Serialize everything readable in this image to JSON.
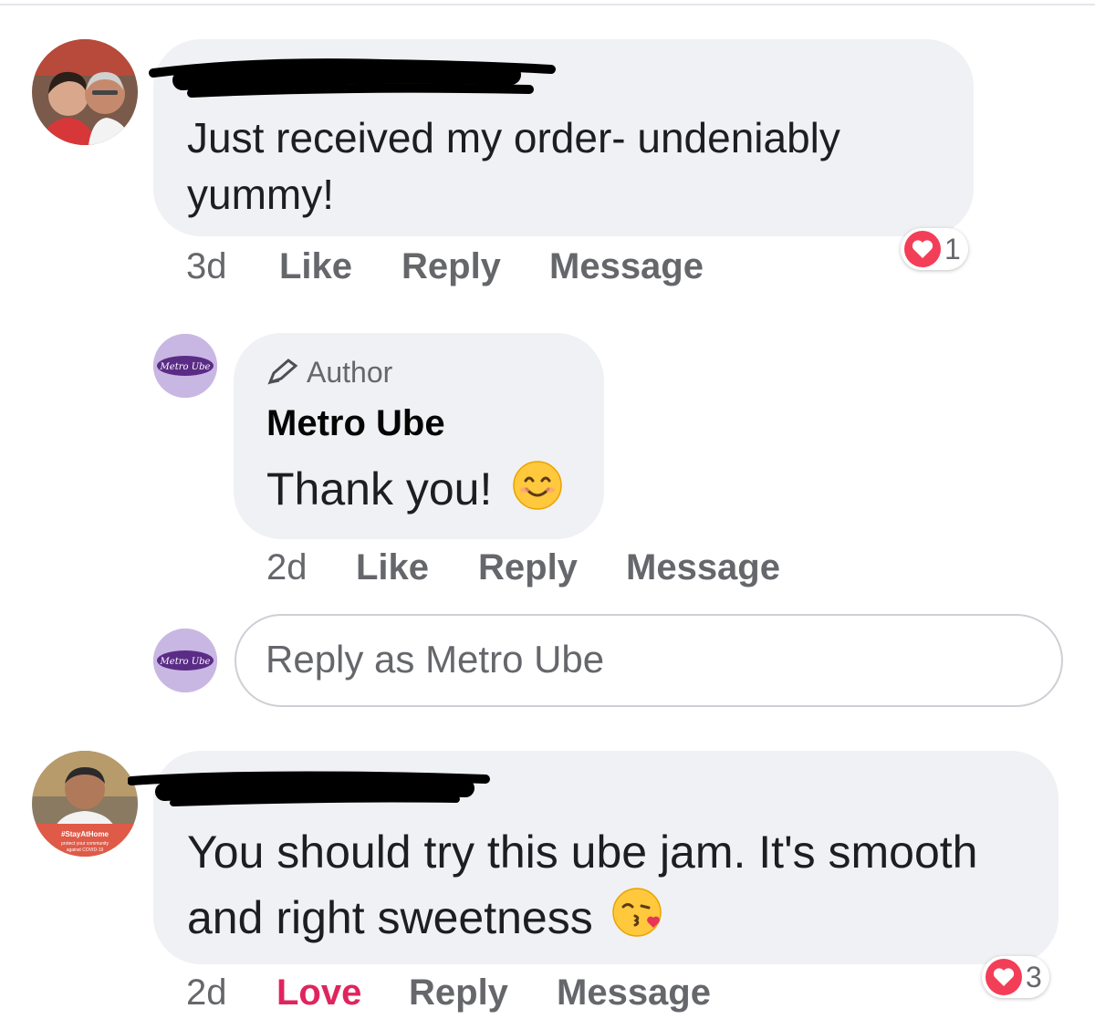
{
  "comments": [
    {
      "text": "Just received my order- undeniably yummy!",
      "time": "3d",
      "actions": {
        "like": "Like",
        "reply": "Reply",
        "message": "Message"
      },
      "reaction_count": "1"
    },
    {
      "badge": "Author",
      "author": "Metro Ube",
      "text": "Thank you!",
      "emoji": "smiling-face-icon",
      "time": "2d",
      "actions": {
        "like": "Like",
        "reply": "Reply",
        "message": "Message"
      }
    },
    {
      "text": "You should try this ube jam. It's smooth and right sweetness",
      "emoji": "kissing-face-icon",
      "time": "2d",
      "actions": {
        "love": "Love",
        "reply": "Reply",
        "message": "Message"
      },
      "reaction_count": "3"
    }
  ],
  "reply_box": {
    "placeholder": "Reply as Metro Ube"
  },
  "page_avatar": {
    "logo_text": "Metro Ube"
  },
  "stay_home_badge": {
    "line1": "#StayAtHome",
    "line2": "protect your community",
    "line3": "against COVID-19"
  },
  "colors": {
    "love": "#e0245e",
    "reaction_heart": "#f33e58",
    "bubble": "#f0f1f4",
    "page_purple": "#c9b7e3"
  }
}
